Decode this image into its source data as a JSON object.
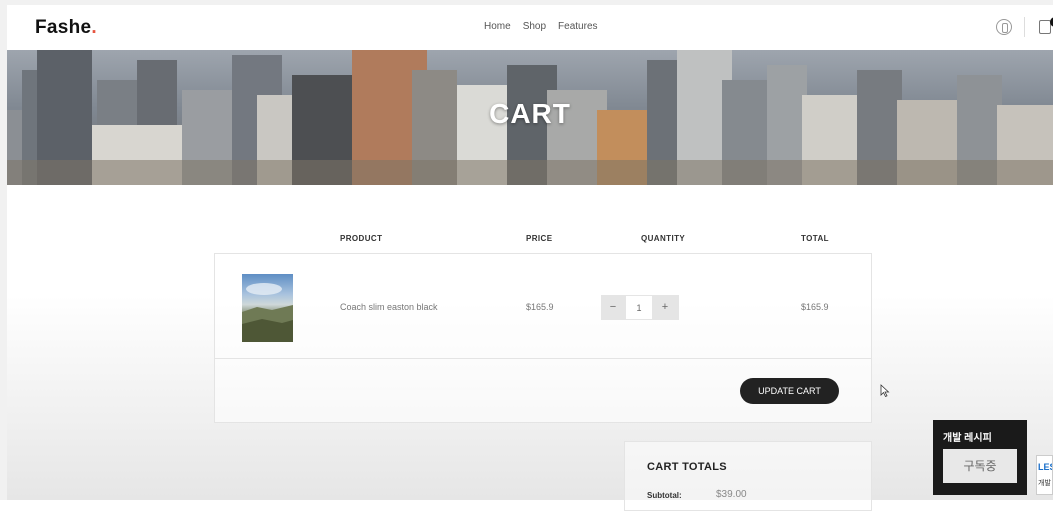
{
  "header": {
    "logo_text": "Fashe",
    "logo_dot": ".",
    "nav": [
      "Home",
      "Shop",
      "Features"
    ],
    "cart_count": "1"
  },
  "banner": {
    "title": "CART"
  },
  "table": {
    "headers": {
      "product": "PRODUCT",
      "price": "PRICE",
      "quantity": "QUANTITY",
      "total": "TOTAL"
    },
    "rows": [
      {
        "name": "Coach slim easton black",
        "price": "$165.9",
        "quantity": "1",
        "total": "$165.9"
      }
    ],
    "minus": "−",
    "plus": "+",
    "update_label": "UPDATE CART"
  },
  "totals": {
    "title": "CART TOTALS",
    "subtotal_label": "Subtotal:",
    "subtotal_value": "$39.00"
  },
  "widget": {
    "title": "개발 레시피",
    "button": "구독중",
    "channel_logo_top": "LES",
    "channel_logo_bottom": "개발"
  },
  "colors": {
    "accent": "#e65540",
    "button_dark": "#222222"
  }
}
